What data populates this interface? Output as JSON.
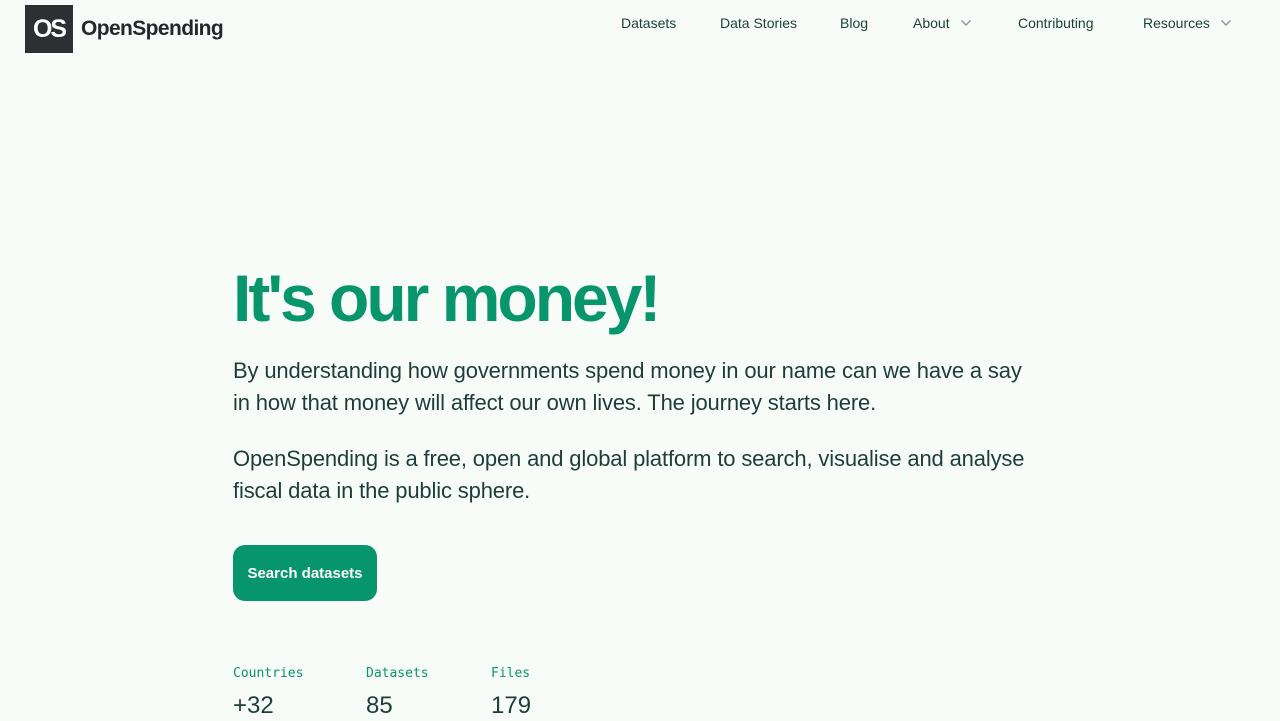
{
  "brand": {
    "logo_mark": "OS",
    "name": "OpenSpending"
  },
  "nav": {
    "items": [
      {
        "label": "Datasets",
        "has_dropdown": false
      },
      {
        "label": "Data Stories",
        "has_dropdown": false
      },
      {
        "label": "Blog",
        "has_dropdown": false
      },
      {
        "label": "About",
        "has_dropdown": true
      },
      {
        "label": "Contributing",
        "has_dropdown": false
      },
      {
        "label": "Resources",
        "has_dropdown": true
      }
    ]
  },
  "hero": {
    "title": "It's our money!",
    "paragraph_1": "By understanding how governments spend money in our name can we have a say in how that money will affect our own lives. The journey starts here.",
    "paragraph_2": "OpenSpending is a free, open and global platform to search, visualise and analyse fiscal data in the public sphere.",
    "cta_label": "Search datasets"
  },
  "stats": [
    {
      "label": "Countries",
      "value": "+32"
    },
    {
      "label": "Datasets",
      "value": "85"
    },
    {
      "label": "Files",
      "value": "179"
    }
  ],
  "colors": {
    "brand_green": "#07956b",
    "text_dark": "#1d3d38",
    "background": "#f7fcf9",
    "logo_bg": "#2d2f33"
  }
}
